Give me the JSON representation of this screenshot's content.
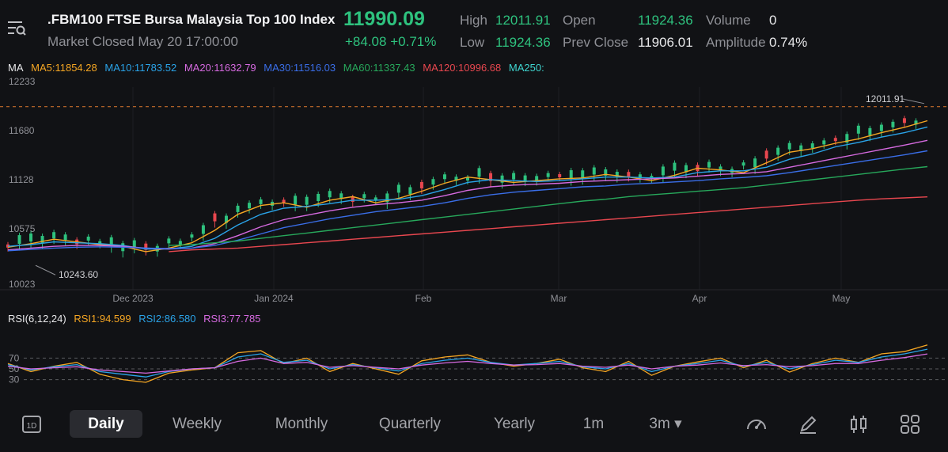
{
  "header": {
    "symbol_title": ".FBM100  FTSE Bursa Malaysia Top 100 Index",
    "market_status": "Market Closed May 20 17:00:00",
    "last_price": "11990.09",
    "change": "+84.08",
    "change_pct": "+0.71%",
    "stats": {
      "high_label": "High",
      "high": "12011.91",
      "low_label": "Low",
      "low": "11924.36",
      "open_label": "Open",
      "open": "11924.36",
      "prev_close_label": "Prev Close",
      "prev_close": "11906.01",
      "volume_label": "Volume",
      "volume": "0",
      "amplitude_label": "Amplitude",
      "amplitude": "0.74%"
    }
  },
  "ma_legend": {
    "label": "MA",
    "ma5": "MA5:11854.28",
    "ma10": "MA10:11783.52",
    "ma20": "MA20:11632.79",
    "ma30": "MA30:11516.03",
    "ma60": "MA60:11337.43",
    "ma120": "MA120:10996.68",
    "ma250": "MA250:"
  },
  "rsi_legend": {
    "label": "RSI(6,12,24)",
    "rsi1": "RSI1:94.599",
    "rsi2": "RSI2:86.580",
    "rsi3": "RSI3:77.785"
  },
  "chart_data": {
    "type": "line",
    "y_ticks": [
      "12233",
      "11680",
      "11128",
      "10575",
      "10023"
    ],
    "y_range": [
      10023,
      12233
    ],
    "x_ticks": [
      "Dec 2023",
      "Jan 2024",
      "Feb",
      "Mar",
      "Apr",
      "May"
    ],
    "high_marker": "12011.91",
    "low_marker": "10243.60",
    "rsi_ticks": [
      "70",
      "50",
      "30"
    ],
    "series": [
      {
        "name": "MA5",
        "color": "#f5a623",
        "values": [
          10430,
          10470,
          10520,
          10490,
          10460,
          10440,
          10380,
          10420,
          10480,
          10620,
          10800,
          10900,
          10930,
          10880,
          10960,
          11000,
          10930,
          10980,
          11060,
          11150,
          11220,
          11190,
          11160,
          11180,
          11200,
          11210,
          11250,
          11220,
          11180,
          11240,
          11320,
          11300,
          11270,
          11380,
          11500,
          11540,
          11600,
          11650,
          11720,
          11780,
          11854
        ]
      },
      {
        "name": "MA10",
        "color": "#2aa3e8",
        "values": [
          10440,
          10460,
          10490,
          10480,
          10470,
          10450,
          10410,
          10410,
          10440,
          10530,
          10680,
          10800,
          10870,
          10890,
          10920,
          10960,
          10960,
          10970,
          11010,
          11080,
          11160,
          11190,
          11180,
          11170,
          11180,
          11200,
          11220,
          11220,
          11210,
          11220,
          11270,
          11290,
          11290,
          11330,
          11420,
          11480,
          11560,
          11610,
          11670,
          11720,
          11784
        ]
      },
      {
        "name": "MA20",
        "color": "#d66ae0",
        "values": [
          10400,
          10420,
          10440,
          10450,
          10450,
          10440,
          10420,
          10410,
          10420,
          10470,
          10560,
          10660,
          10740,
          10790,
          10840,
          10880,
          10910,
          10930,
          10960,
          11010,
          11070,
          11110,
          11130,
          11140,
          11150,
          11170,
          11180,
          11190,
          11200,
          11210,
          11230,
          11250,
          11260,
          11280,
          11330,
          11380,
          11430,
          11480,
          11530,
          11580,
          11633
        ]
      },
      {
        "name": "MA30",
        "color": "#3a6ee8",
        "values": [
          10390,
          10405,
          10420,
          10430,
          10435,
          10430,
          10420,
          10415,
          10420,
          10450,
          10510,
          10580,
          10650,
          10700,
          10750,
          10790,
          10830,
          10860,
          10890,
          10930,
          10980,
          11020,
          11050,
          11070,
          11090,
          11110,
          11120,
          11140,
          11150,
          11165,
          11180,
          11200,
          11215,
          11235,
          11270,
          11310,
          11350,
          11390,
          11430,
          11470,
          11516
        ]
      },
      {
        "name": "MA60",
        "color": "#27a85b",
        "values": [
          null,
          null,
          null,
          null,
          null,
          null,
          null,
          10450,
          10460,
          10480,
          10500,
          10530,
          10560,
          10590,
          10620,
          10650,
          10680,
          10710,
          10740,
          10770,
          10800,
          10830,
          10860,
          10890,
          10920,
          10950,
          10970,
          11000,
          11020,
          11040,
          11060,
          11080,
          11100,
          11130,
          11160,
          11190,
          11220,
          11250,
          11280,
          11310,
          11337
        ]
      },
      {
        "name": "MA120",
        "color": "#e8474f",
        "values": [
          null,
          null,
          null,
          null,
          null,
          null,
          null,
          10380,
          10400,
          10410,
          10420,
          10440,
          10460,
          10480,
          10500,
          10520,
          10540,
          10560,
          10580,
          10600,
          10620,
          10640,
          10660,
          10680,
          10700,
          10720,
          10740,
          10760,
          10780,
          10800,
          10820,
          10840,
          10860,
          10880,
          10900,
          10920,
          10940,
          10960,
          10975,
          10985,
          10997
        ]
      }
    ],
    "rsi_series": [
      {
        "name": "RSI1",
        "color": "#f5a623",
        "values": [
          60,
          45,
          55,
          62,
          40,
          30,
          25,
          42,
          48,
          52,
          80,
          84,
          60,
          70,
          45,
          60,
          50,
          40,
          65,
          72,
          76,
          62,
          55,
          60,
          68,
          52,
          45,
          64,
          38,
          55,
          63,
          70,
          52,
          66,
          44,
          60,
          70,
          62,
          78,
          82,
          94.6
        ]
      },
      {
        "name": "RSI2",
        "color": "#2aa3e8",
        "values": [
          58,
          48,
          54,
          58,
          45,
          40,
          35,
          45,
          50,
          52,
          72,
          78,
          62,
          66,
          50,
          58,
          52,
          46,
          60,
          66,
          70,
          62,
          57,
          60,
          64,
          54,
          50,
          60,
          45,
          55,
          60,
          66,
          55,
          62,
          50,
          58,
          66,
          62,
          72,
          78,
          86.6
        ]
      },
      {
        "name": "RSI3",
        "color": "#d66ae0",
        "values": [
          55,
          50,
          52,
          54,
          48,
          45,
          42,
          46,
          50,
          52,
          64,
          70,
          60,
          62,
          53,
          56,
          53,
          50,
          57,
          61,
          64,
          60,
          57,
          58,
          60,
          55,
          53,
          57,
          50,
          55,
          57,
          61,
          56,
          58,
          54,
          56,
          60,
          60,
          66,
          71,
          77.8
        ]
      }
    ]
  },
  "toolbar": {
    "tabs": [
      "Daily",
      "Weekly",
      "Monthly",
      "Quarterly",
      "Yearly",
      "1m",
      "3m ▾"
    ],
    "icon_1d": "1D"
  },
  "colors": {
    "up": "#2ec27e",
    "down": "#e8474f",
    "background": "#111215"
  }
}
